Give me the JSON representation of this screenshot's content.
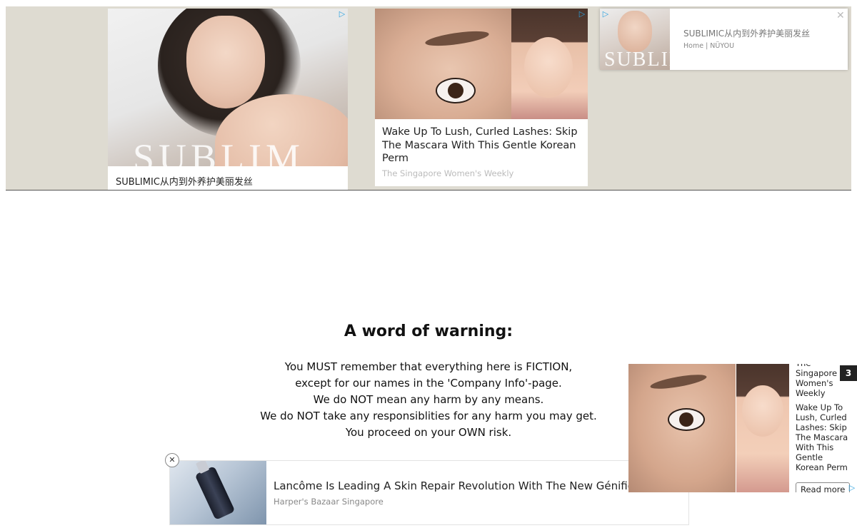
{
  "top_ads": {
    "card1": {
      "brand_overlay": "SUBLIM",
      "caption": "SUBLIMIC从内到外养护美丽发丝",
      "adchoices_icon": "adchoices-icon"
    },
    "card2": {
      "title": "Wake Up To Lush, Curled Lashes: Skip The Mascara With This Gentle Korean Perm",
      "source": "The Singapore Women's Weekly",
      "adchoices_icon": "adchoices-icon"
    },
    "card3": {
      "brand_overlay": "SUBLIM",
      "title": "SUBLIMIC从内到外养护美丽发丝",
      "source": "Home | NÜYOU",
      "close_icon": "close-icon",
      "adchoices_icon": "adchoices-icon"
    }
  },
  "warning": {
    "title": "A word of warning:",
    "lines": [
      "You MUST remember that everything here is FICTION,",
      "except for our names in the 'Company Info'-page.",
      "We do NOT mean any harm by any means.",
      "We do NOT take any responsiblities for any harm you may get.",
      "You proceed on your OWN risk."
    ]
  },
  "bottom_ad": {
    "title": "Lancôme Is Leading A Skin Repair Revolution With The New Génifique",
    "source": "Harper's Bazaar Singapore",
    "close_symbol": "✕"
  },
  "side_ad": {
    "source": "The Singapore Women's Weekly",
    "title": "Wake Up To Lush, Curled Lashes: Skip The Mascara With This Gentle Korean Perm",
    "cta": "Read more",
    "count": "3"
  },
  "icons": {
    "adchoices": "▷",
    "close": "✕"
  }
}
